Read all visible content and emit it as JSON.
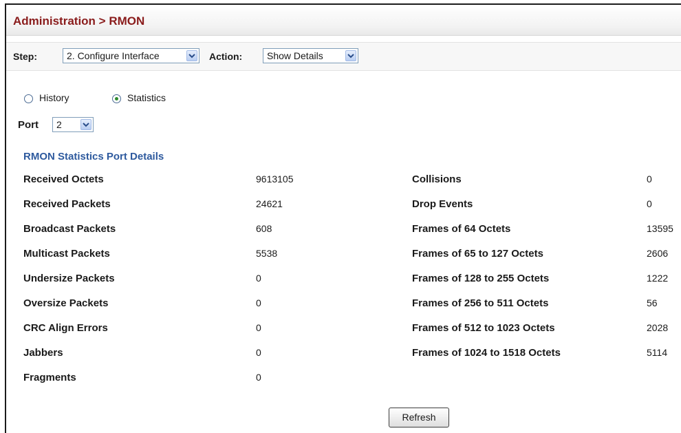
{
  "header": {
    "title": "Administration > RMON"
  },
  "stepbar": {
    "step_label": "Step:",
    "step_value": "2. Configure Interface",
    "action_label": "Action:",
    "action_value": "Show Details"
  },
  "mode": {
    "history_label": "History",
    "statistics_label": "Statistics",
    "selected": "Statistics"
  },
  "port": {
    "label": "Port",
    "value": "2"
  },
  "section_title": "RMON Statistics Port Details",
  "stats_left": [
    {
      "label": "Received Octets",
      "value": "9613105"
    },
    {
      "label": "Received Packets",
      "value": "24621"
    },
    {
      "label": "Broadcast Packets",
      "value": "608"
    },
    {
      "label": "Multicast Packets",
      "value": "5538"
    },
    {
      "label": "Undersize Packets",
      "value": "0"
    },
    {
      "label": "Oversize Packets",
      "value": "0"
    },
    {
      "label": "CRC Align Errors",
      "value": "0"
    },
    {
      "label": "Jabbers",
      "value": "0"
    },
    {
      "label": "Fragments",
      "value": "0"
    }
  ],
  "stats_right": [
    {
      "label": "Collisions",
      "value": "0"
    },
    {
      "label": "Drop Events",
      "value": "0"
    },
    {
      "label": "Frames of 64 Octets",
      "value": "13595"
    },
    {
      "label": "Frames of 65 to 127 Octets",
      "value": "2606"
    },
    {
      "label": "Frames of 128 to 255 Octets",
      "value": "1222"
    },
    {
      "label": "Frames of 256 to 511 Octets",
      "value": "56"
    },
    {
      "label": "Frames of 512 to 1023 Octets",
      "value": "2028"
    },
    {
      "label": "Frames of 1024 to 1518 Octets",
      "value": "5114"
    }
  ],
  "refresh_label": "Refresh"
}
